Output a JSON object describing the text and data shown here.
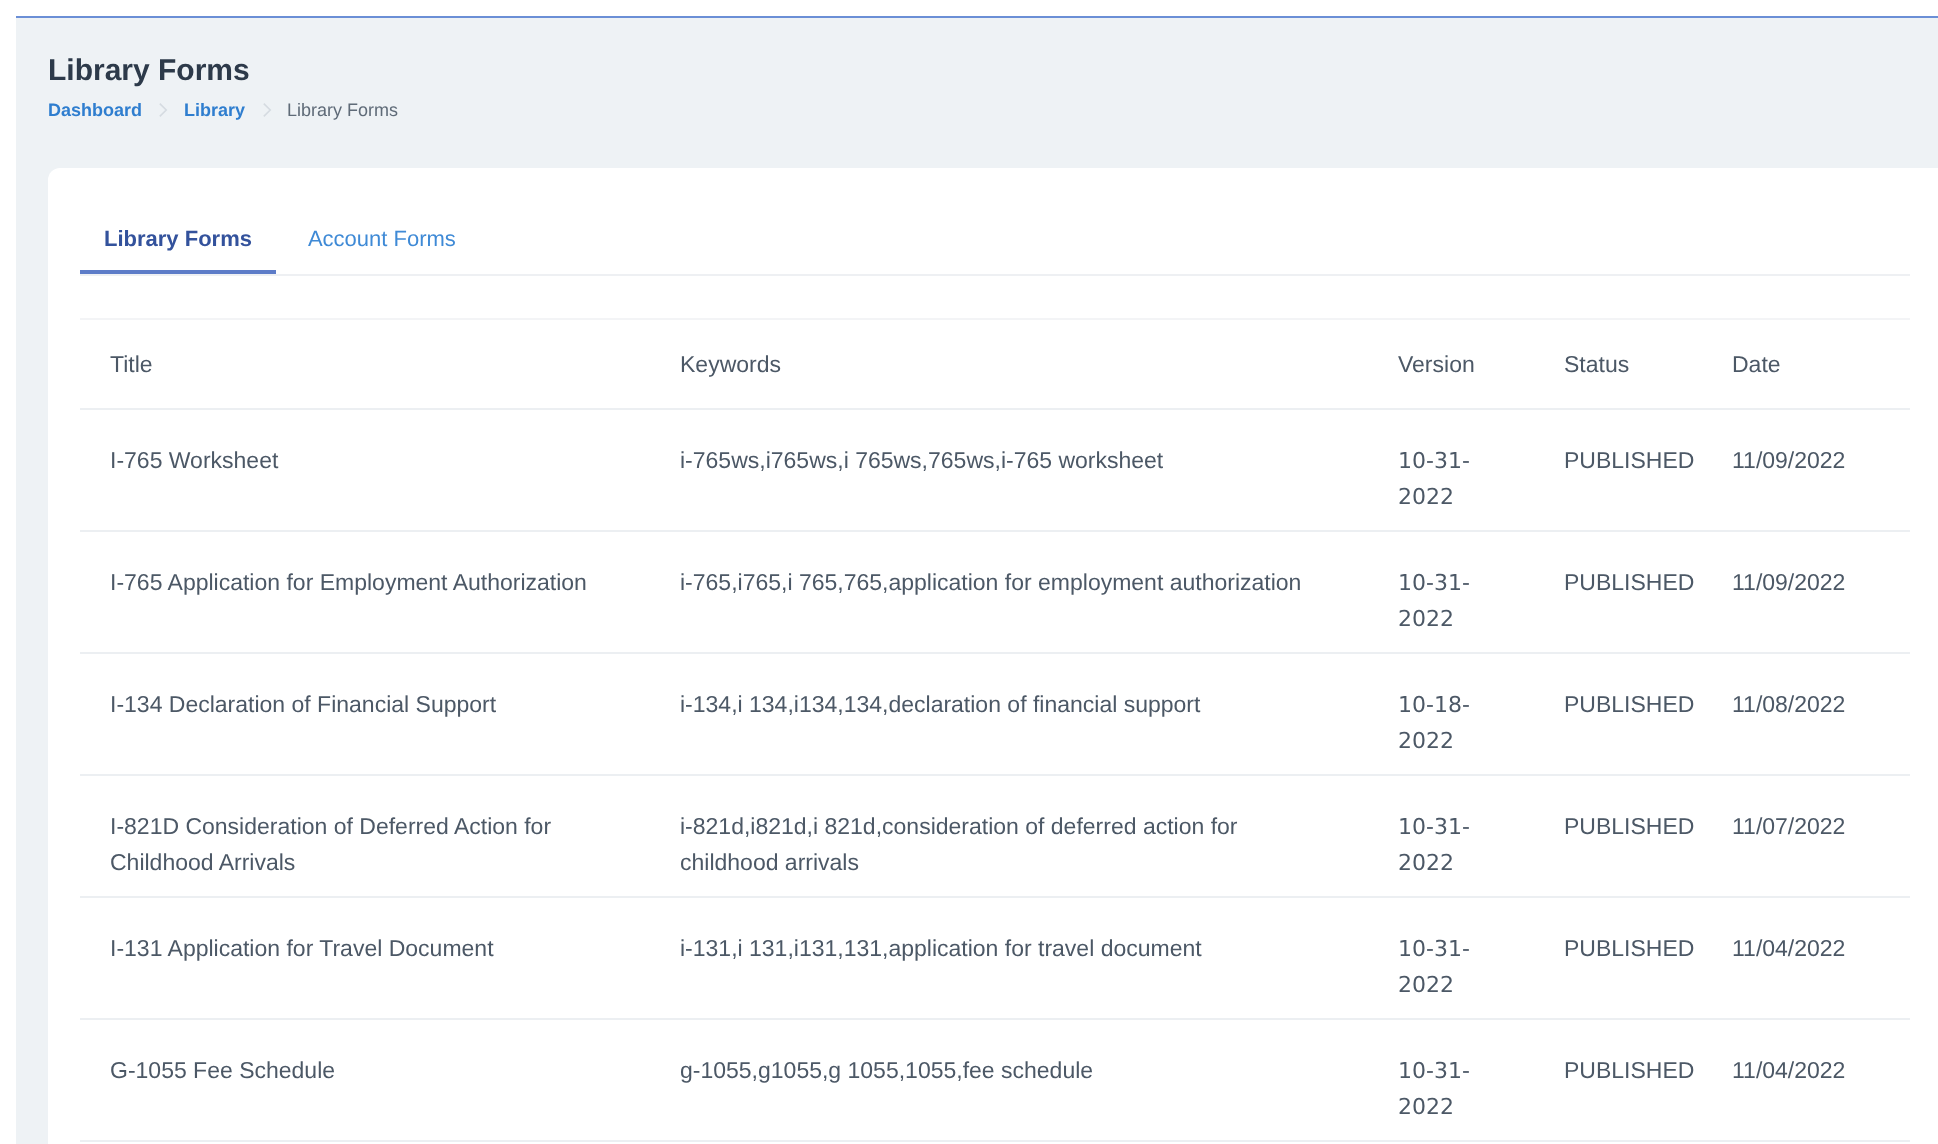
{
  "page": {
    "title": "Library Forms"
  },
  "breadcrumbs": [
    {
      "label": "Dashboard",
      "link": true
    },
    {
      "label": "Library",
      "link": true
    },
    {
      "label": "Library Forms",
      "link": false
    }
  ],
  "tabs": [
    {
      "label": "Library Forms",
      "selected": true
    },
    {
      "label": "Account Forms",
      "selected": false
    }
  ],
  "table": {
    "columns": [
      "Title",
      "Keywords",
      "Version",
      "Status",
      "Date"
    ],
    "rows": [
      [
        "I-765 Worksheet",
        "i-765ws,i765ws,i 765ws,765ws,i-765 worksheet",
        "10-31-2022",
        "PUBLISHED",
        "11/09/2022"
      ],
      [
        "I-765 Application for Employment Authorization",
        "i-765,i765,i 765,765,application for employment authorization",
        "10-31-2022",
        "PUBLISHED",
        "11/09/2022"
      ],
      [
        "I-134 Declaration of Financial Support",
        "i-134,i 134,i134,134,declaration of financial support",
        "10-18-2022",
        "PUBLISHED",
        "11/08/2022"
      ],
      [
        "I-821D Consideration of Deferred Action for Childhood Arrivals",
        "i-821d,i821d,i 821d,consideration of deferred action for childhood arrivals",
        "10-31-2022",
        "PUBLISHED",
        "11/07/2022"
      ],
      [
        "I-131 Application for Travel Document",
        "i-131,i 131,i131,131,application for travel document",
        "10-31-2022",
        "PUBLISHED",
        "11/04/2022"
      ],
      [
        "G-1055 Fee Schedule",
        "g-1055,g1055,g 1055,1055,fee schedule",
        "10-31-2022",
        "PUBLISHED",
        "11/04/2022"
      ]
    ]
  }
}
